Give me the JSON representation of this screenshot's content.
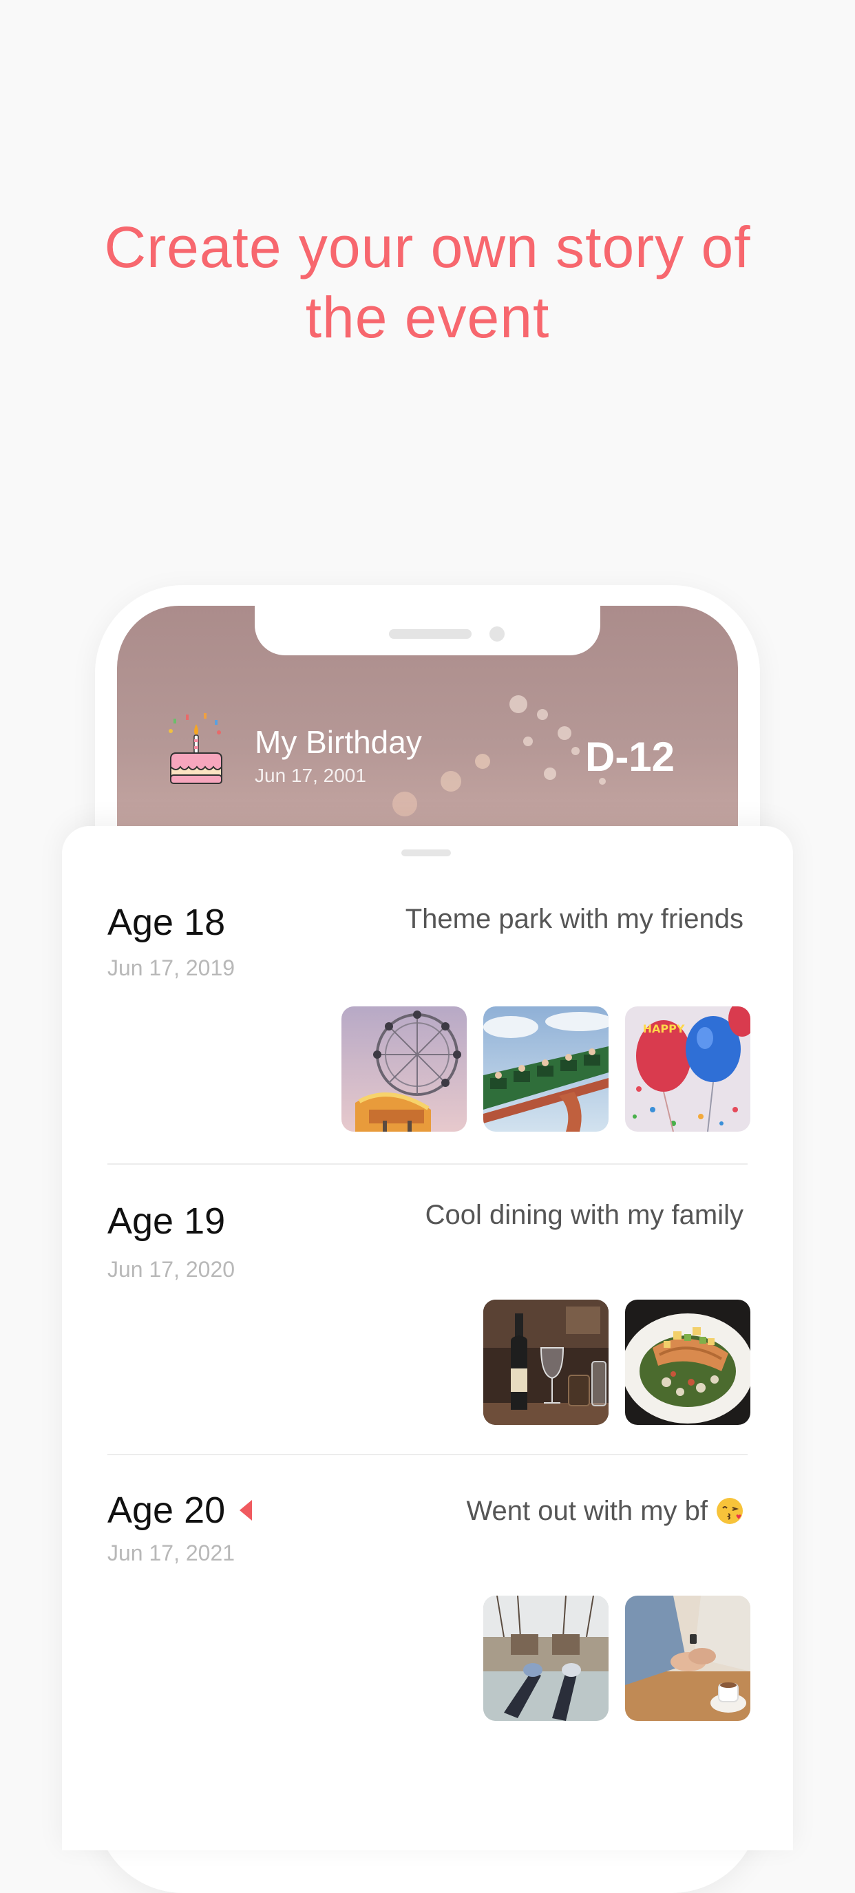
{
  "headline": {
    "line1": "Create your own story of",
    "line2": "the event"
  },
  "event": {
    "title": "My Birthday",
    "date": "Jun 17, 2001",
    "dday": "D-12",
    "icon": "birthday-cake-icon"
  },
  "timeline": [
    {
      "age": "Age 18",
      "date": "Jun 17, 2019",
      "description": "Theme park with my friends",
      "photos": [
        "ferris-wheel-photo",
        "roller-coaster-photo",
        "birthday-balloons-photo"
      ]
    },
    {
      "age": "Age 19",
      "date": "Jun 17, 2020",
      "description": "Cool dining with my family",
      "photos": [
        "wine-bottle-photo",
        "salmon-dish-photo"
      ]
    },
    {
      "age": "Age 20",
      "date": "Jun 17, 2021",
      "description": "Went out with my bf",
      "current_indicator": "caret-left-icon",
      "emoji": "kissing-face-emoji",
      "photos": [
        "feet-on-table-photo",
        "couple-holding-hands-photo"
      ]
    }
  ],
  "colors": {
    "accent": "#f7676e",
    "caret": "#f05a5f",
    "header_bg": "#ab8c8b",
    "page_bg": "#f9f9f9"
  }
}
